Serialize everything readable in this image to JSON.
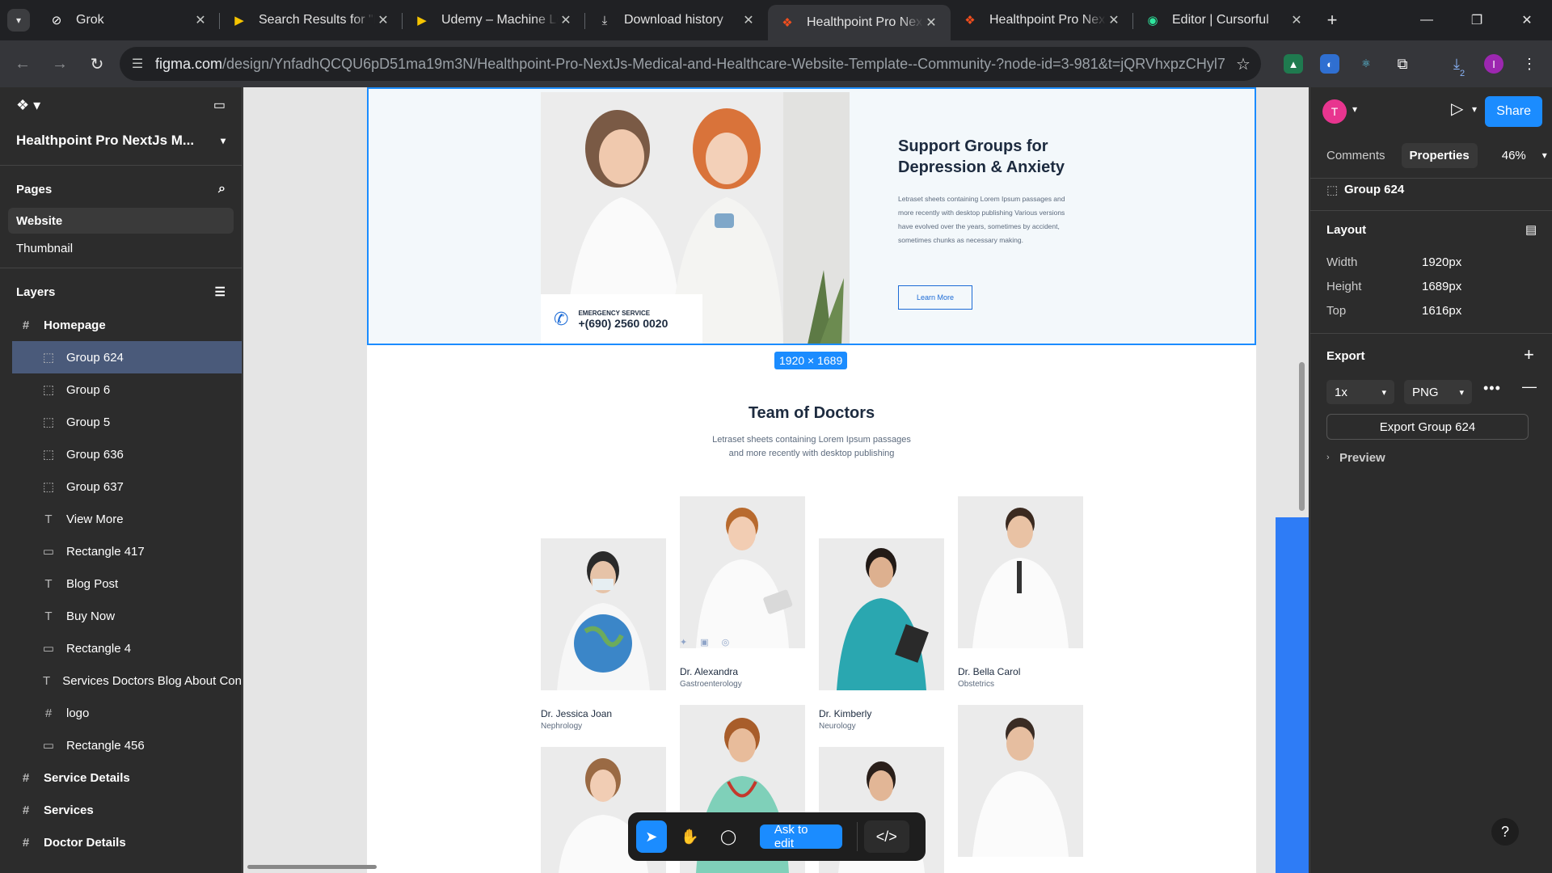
{
  "browser": {
    "tabs": [
      {
        "title": "Grok",
        "icon": "grok-icon"
      },
      {
        "title": "Search Results for \"M",
        "icon": "udemy-icon"
      },
      {
        "title": "Udemy – Machine Le",
        "icon": "udemy-icon"
      },
      {
        "title": "Download history",
        "icon": "download-icon"
      },
      {
        "title": "Healthpoint Pro Next",
        "icon": "figma-icon",
        "active": true
      },
      {
        "title": "Healthpoint Pro Nex",
        "icon": "figma-icon"
      },
      {
        "title": "Editor | Cursorful",
        "icon": "cursorful-icon"
      }
    ],
    "url_host": "figma.com",
    "url_path": "/design/YnfadhQCQU6pD51ma19m3N/Healthpoint-Pro-NextJs-Medical-and-Healthcare-Website-Template--Community-?node-id=3-981&t=jQRVhxpzCHyl7...",
    "profile_initial": "I",
    "download_badge": "2"
  },
  "left_panel": {
    "file_title": "Healthpoint Pro NextJs M...",
    "pages_label": "Pages",
    "pages": [
      "Website",
      "Thumbnail"
    ],
    "layers_label": "Layers",
    "layers": [
      {
        "name": "Homepage",
        "type": "frame",
        "icon": "#"
      },
      {
        "name": "Group 624",
        "type": "group",
        "icon": "⬚",
        "selected": true
      },
      {
        "name": "Group 6",
        "type": "group",
        "icon": "⬚"
      },
      {
        "name": "Group 5",
        "type": "group",
        "icon": "⬚"
      },
      {
        "name": "Group 636",
        "type": "group",
        "icon": "⬚"
      },
      {
        "name": "Group 637",
        "type": "group",
        "icon": "⬚"
      },
      {
        "name": "View More",
        "type": "text",
        "icon": "T"
      },
      {
        "name": "Rectangle 417",
        "type": "rect",
        "icon": "▭"
      },
      {
        "name": "Blog Post",
        "type": "text",
        "icon": "T"
      },
      {
        "name": "Buy Now",
        "type": "text",
        "icon": "T"
      },
      {
        "name": "Rectangle 4",
        "type": "rect",
        "icon": "▭"
      },
      {
        "name": "Services Doctors Blog About Con",
        "type": "text",
        "icon": "T"
      },
      {
        "name": "logo",
        "type": "frame-child",
        "icon": "#"
      },
      {
        "name": "Rectangle 456",
        "type": "rect",
        "icon": "▭"
      },
      {
        "name": "Service Details",
        "type": "frame",
        "icon": "#"
      },
      {
        "name": "Services",
        "type": "frame",
        "icon": "#"
      },
      {
        "name": "Doctor Details",
        "type": "frame",
        "icon": "#"
      }
    ]
  },
  "canvas": {
    "emergency_label": "EMERGENCY SERVICE",
    "emergency_phone": "+(690) 2560 0020",
    "support_title": "Support Groups for Depression & Anxiety",
    "support_text": "Letraset sheets containing Lorem Ipsum passages and more recently with desktop publishing Various versions have evolved over the years, sometimes by accident, sometimes chunks as necessary making.",
    "learn_more": "Learn More",
    "selection_size": "1920 × 1689",
    "team_title": "Team of Doctors",
    "team_sub_1": "Letraset sheets containing Lorem Ipsum passages",
    "team_sub_2": "and more recently with desktop publishing",
    "doctors": [
      {
        "name": "Dr. Jessica Joan",
        "spec": "Nephrology"
      },
      {
        "name": "Dr. Alexandra",
        "spec": "Gastroenterology"
      },
      {
        "name": "Dr. Kimberly",
        "spec": "Neurology"
      },
      {
        "name": "Dr. Bella Carol",
        "spec": "Obstetrics"
      }
    ]
  },
  "toolbar": {
    "ask_to_edit": "Ask to edit"
  },
  "right_panel": {
    "avatar_initial": "T",
    "share": "Share",
    "tab_comments": "Comments",
    "tab_properties": "Properties",
    "zoom": "46%",
    "selection_name": "Group 624",
    "layout_label": "Layout",
    "width_label": "Width",
    "width_value": "1920px",
    "height_label": "Height",
    "height_value": "1689px",
    "top_label": "Top",
    "top_value": "1616px",
    "export_label": "Export",
    "export_scale": "1x",
    "export_format": "PNG",
    "export_button": "Export Group 624",
    "preview_label": "Preview"
  },
  "colors": {
    "accent": "#1b8cff",
    "brand_blue": "#1c6bd6",
    "panel": "#2c2c2c"
  }
}
